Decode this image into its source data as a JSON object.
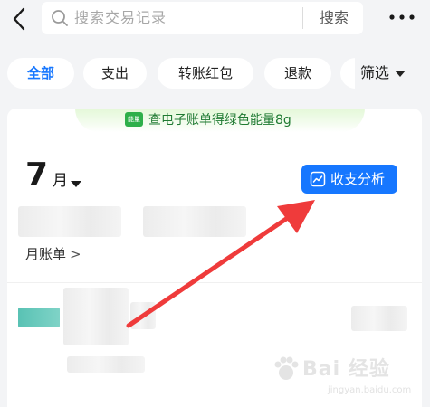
{
  "header": {
    "search_placeholder": "搜索交易记录",
    "search_button": "搜索"
  },
  "filters": {
    "chips": [
      "全部",
      "支出",
      "转账红包",
      "退款"
    ],
    "active_index": 0,
    "filter_label": "筛选"
  },
  "promo": {
    "badge_text": "能量",
    "text": "查电子账单得绿色能量8g"
  },
  "summary": {
    "month_number": "7",
    "month_unit": "月",
    "analysis_button": "收支分析",
    "monthly_bill_link": "月账单",
    "monthly_bill_chevron": ">"
  },
  "watermark": {
    "text": "Bai 经验",
    "sub": "jingyan.baidu.com"
  },
  "colors": {
    "accent": "#1677ff",
    "promo_green": "#2eaf4a",
    "annotation_arrow": "#ef3b3b",
    "page_bg": "#f3f4f6"
  },
  "icons": {
    "back": "chevron-left-icon",
    "search": "search-icon",
    "more": "more-dots-icon",
    "filter_dropdown": "caret-down-icon",
    "analysis": "trend-chart-icon",
    "month_dropdown": "caret-down-icon"
  }
}
